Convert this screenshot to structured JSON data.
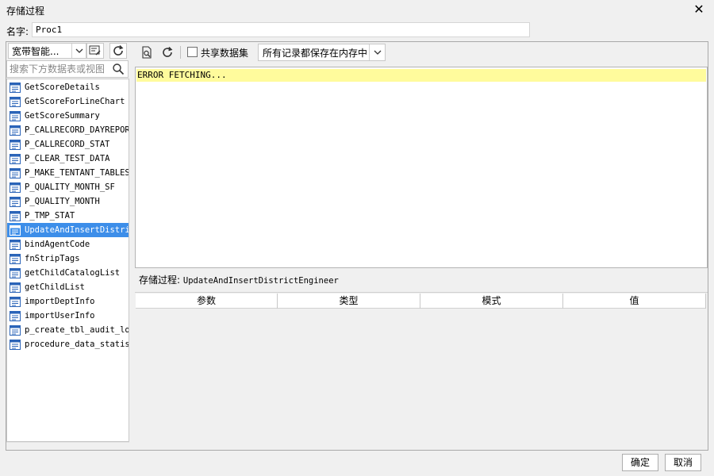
{
  "window": {
    "title": "存储过程"
  },
  "name_field": {
    "label": "名字:",
    "value": "Proc1"
  },
  "left": {
    "datasource": "宽带智能...",
    "search_placeholder": "搜索下方数据表或视图",
    "items": [
      "GetScoreDetails",
      "GetScoreForLineChart",
      "GetScoreSummary",
      "P_CALLRECORD_DAYREPORT",
      "P_CALLRECORD_STAT",
      "P_CLEAR_TEST_DATA",
      "P_MAKE_TENTANT_TABLES",
      "P_QUALITY_MONTH_SF",
      "P_QUALITY_MONTH",
      "P_TMP_STAT",
      "UpdateAndInsertDistrictEngineer",
      "bindAgentCode",
      "fnStripTags",
      "getChildCatalogList",
      "getChildList",
      "importDeptInfo",
      "importUserInfo",
      "p_create_tbl_audit_log",
      "procedure_data_statistics"
    ],
    "selected_index": 10
  },
  "right": {
    "shared_label": "共享数据集",
    "shared_checked": false,
    "memory_option": "所有记录都保存在内存中",
    "editor_text": "ERROR FETCHING...",
    "proc_label": "存储过程:",
    "proc_name": "UpdateAndInsertDistrictEngineer",
    "columns": [
      "参数",
      "类型",
      "模式",
      "值"
    ]
  },
  "buttons": {
    "ok": "确定",
    "cancel": "取消"
  },
  "colors": {
    "selection": "#3d8ee9",
    "error_highlight": "#fffb9c"
  }
}
